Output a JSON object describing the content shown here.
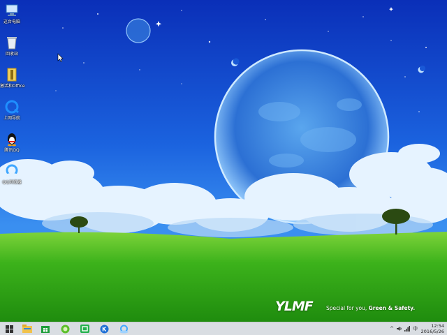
{
  "desktop": {
    "icons": [
      {
        "label": "这台电脑",
        "icon": "this-pc-icon"
      },
      {
        "label": "回收站",
        "icon": "recycle-bin-icon"
      },
      {
        "label": "激活和Office",
        "icon": "activation-folder-icon"
      },
      {
        "label": "上网导航",
        "icon": "web-navigation-icon"
      },
      {
        "label": "腾讯QQ",
        "icon": "qq-penguin-icon"
      },
      {
        "label": "QQ浏览器",
        "icon": "qq-browser-icon"
      }
    ]
  },
  "wallpaper": {
    "brand": "YLMF",
    "slogan_prefix": "Special for you, ",
    "slogan_bold": "Green & Safety."
  },
  "taskbar": {
    "buttons": [
      {
        "icon": "windows-start-icon"
      },
      {
        "icon": "file-explorer-icon"
      },
      {
        "icon": "windows-store-icon"
      },
      {
        "icon": "green-app-icon"
      },
      {
        "icon": "iqiyi-icon"
      },
      {
        "icon": "k-app-icon"
      },
      {
        "icon": "qq-browser-icon"
      }
    ],
    "tray": {
      "chevron": "^",
      "volume_icon": "volume-icon",
      "network_icon": "network-icon",
      "ime": "中",
      "time": "12:54",
      "date": "2016/5/26"
    }
  },
  "colors": {
    "sky_top": "#0a2fb8",
    "sky_mid": "#1f73e6",
    "grass": "#3bb51c",
    "taskbar": "#d9dde2"
  }
}
